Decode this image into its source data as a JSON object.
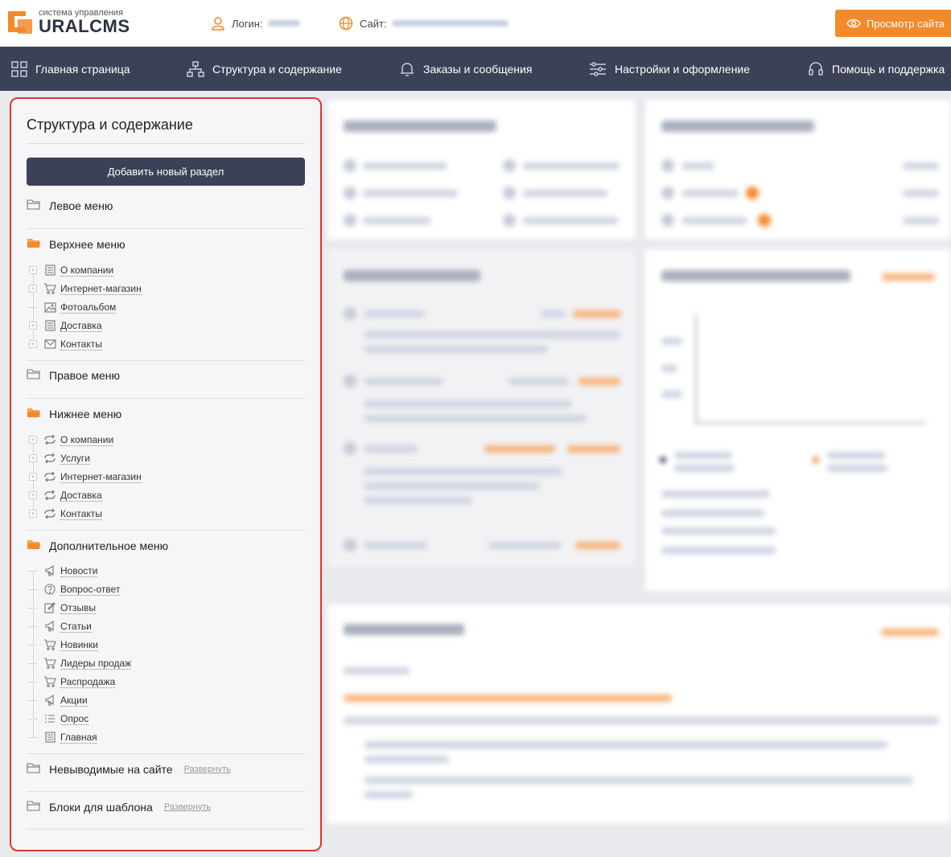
{
  "header": {
    "logo_sub": "система управления",
    "logo_main": "URALCMS",
    "login_label": "Логин:",
    "site_label": "Сайт:",
    "view_site_button": "Просмотр сайта"
  },
  "nav": {
    "items": [
      {
        "label": "Главная страница",
        "icon": "grid-icon"
      },
      {
        "label": "Структура и содержание",
        "icon": "structure-icon"
      },
      {
        "label": "Заказы и сообщения",
        "icon": "bell-icon"
      },
      {
        "label": "Настройки и оформление",
        "icon": "sliders-icon"
      },
      {
        "label": "Помощь и поддержка",
        "icon": "headset-icon"
      }
    ]
  },
  "sidebar": {
    "title": "Структура и содержание",
    "add_button": "Добавить новый раздел",
    "expand_label": "Развернуть",
    "sections": [
      {
        "name": "Левое меню",
        "open": false,
        "items": []
      },
      {
        "name": "Верхнее меню",
        "open": true,
        "items": [
          {
            "label": "О компании",
            "icon": "page-icon",
            "expandable": true
          },
          {
            "label": "Интернет-магазин",
            "icon": "cart-icon",
            "expandable": true
          },
          {
            "label": "Фотоальбом",
            "icon": "image-icon",
            "expandable": false
          },
          {
            "label": "Доставка",
            "icon": "page-icon",
            "expandable": true
          },
          {
            "label": "Контакты",
            "icon": "mail-icon",
            "expandable": true
          }
        ]
      },
      {
        "name": "Правое меню",
        "open": false,
        "items": []
      },
      {
        "name": "Нижнее меню",
        "open": true,
        "items": [
          {
            "label": "О компании",
            "icon": "link-icon",
            "expandable": true
          },
          {
            "label": "Услуги",
            "icon": "link-icon",
            "expandable": true
          },
          {
            "label": "Интернет-магазин",
            "icon": "link-icon",
            "expandable": true
          },
          {
            "label": "Доставка",
            "icon": "link-icon",
            "expandable": true
          },
          {
            "label": "Контакты",
            "icon": "link-icon",
            "expandable": true
          }
        ]
      },
      {
        "name": "Дополнительное меню",
        "open": true,
        "items": [
          {
            "label": "Новости",
            "icon": "megaphone-icon",
            "expandable": false
          },
          {
            "label": "Вопрос-ответ",
            "icon": "question-icon",
            "expandable": false
          },
          {
            "label": "Отзывы",
            "icon": "edit-icon",
            "expandable": false
          },
          {
            "label": "Статьи",
            "icon": "megaphone-icon",
            "expandable": false
          },
          {
            "label": "Новинки",
            "icon": "cart-icon",
            "expandable": false
          },
          {
            "label": "Лидеры продаж",
            "icon": "cart-icon",
            "expandable": false
          },
          {
            "label": "Распродажа",
            "icon": "cart-icon",
            "expandable": false
          },
          {
            "label": "Акции",
            "icon": "megaphone-icon",
            "expandable": false
          },
          {
            "label": "Опрос",
            "icon": "list-icon",
            "expandable": false
          },
          {
            "label": "Главная",
            "icon": "page-icon",
            "expandable": false
          }
        ]
      },
      {
        "name": "Невыводимые на сайте",
        "open": false,
        "items": [],
        "expand": true
      },
      {
        "name": "Блоки для шаблона",
        "open": false,
        "items": [],
        "expand": true
      }
    ]
  },
  "colors": {
    "accent": "#f38a2a",
    "nav_bg": "#3b4257",
    "highlight_border": "#e3342f"
  }
}
